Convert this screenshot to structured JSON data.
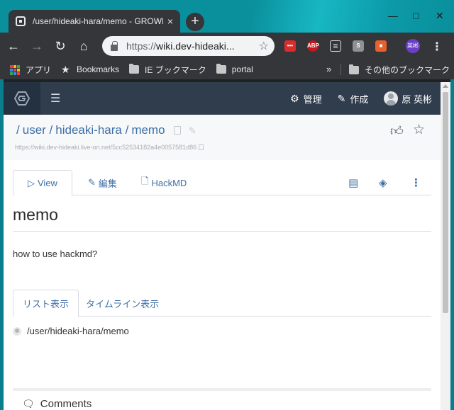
{
  "browser": {
    "tab_title": "/user/hideaki-hara/memo - GROWI",
    "tab_close": "×",
    "new_tab": "+",
    "url_prefix": "https://",
    "url_host": "wiki.dev-hideaki...",
    "profile_initials": "英彬",
    "extensions": [
      "ABP",
      "S"
    ]
  },
  "bookmarks": {
    "apps": "アプリ",
    "bookmarks": "Bookmarks",
    "ie": "IE ブックマーク",
    "portal": "portal",
    "more": "»",
    "other": "その他のブックマーク"
  },
  "appnav": {
    "admin": "管理",
    "create": "作成",
    "user": "原 英彬"
  },
  "page": {
    "crumb": {
      "sep1": "/",
      "user": "user",
      "sep2": "/",
      "owner": "hideaki-hara",
      "sep3": "/",
      "name": "memo"
    },
    "permalink": "https://wiki.dev-hideaki.live-on.net/5cc52534182a4e0057581d86",
    "tabs": {
      "view": "View",
      "edit": "編集",
      "hackmd": "HackMD"
    },
    "title": "memo",
    "body": "how to use hackmd?",
    "list_tabs": {
      "list": "リスト表示",
      "timeline": "タイムライン表示"
    },
    "list_item": "/user/hideaki-hara/memo",
    "comments": "Comments"
  },
  "colors": {
    "nav_bg": "#2f3d4d",
    "link": "#3f6fa7",
    "frame": "#0b7e8e"
  }
}
